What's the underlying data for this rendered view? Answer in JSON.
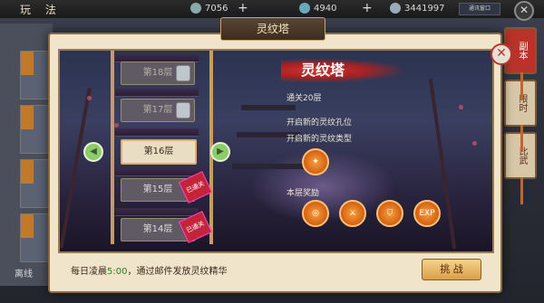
{
  "topbar": {
    "title": "玩 法",
    "res1_value": "7056",
    "res2_value": "4940",
    "res3_value": "3441997",
    "tiny_button": "通讯窗口"
  },
  "left": {
    "bottom_label": "离线"
  },
  "right_tabs": [
    "副本",
    "限时",
    "比武"
  ],
  "modal": {
    "title": "灵纹塔",
    "floors": [
      {
        "label": "第18层",
        "state": "locked"
      },
      {
        "label": "第17层",
        "state": "locked"
      },
      {
        "label": "第16层",
        "state": "current"
      },
      {
        "label": "第15层",
        "state": "cleared"
      },
      {
        "label": "第14层",
        "state": "cleared"
      }
    ],
    "cleared_badge": "已通关",
    "info": {
      "heading": "灵纹塔",
      "clear_line": "通关20层",
      "unlock_slot": "开启新的灵纹孔位",
      "unlock_type": "开启新的灵纹类型",
      "reward_label": "本层奖励",
      "exp_label": "EXP"
    },
    "bottom_prefix": "每日凌晨",
    "bottom_time": "5:00",
    "bottom_suffix": "，通过邮件发放灵纹精华",
    "challenge_label": "挑 战"
  },
  "colors": {
    "accent_orange": "#d46010",
    "cleared_red": "#c4243a",
    "green_time": "#2e7d25"
  }
}
